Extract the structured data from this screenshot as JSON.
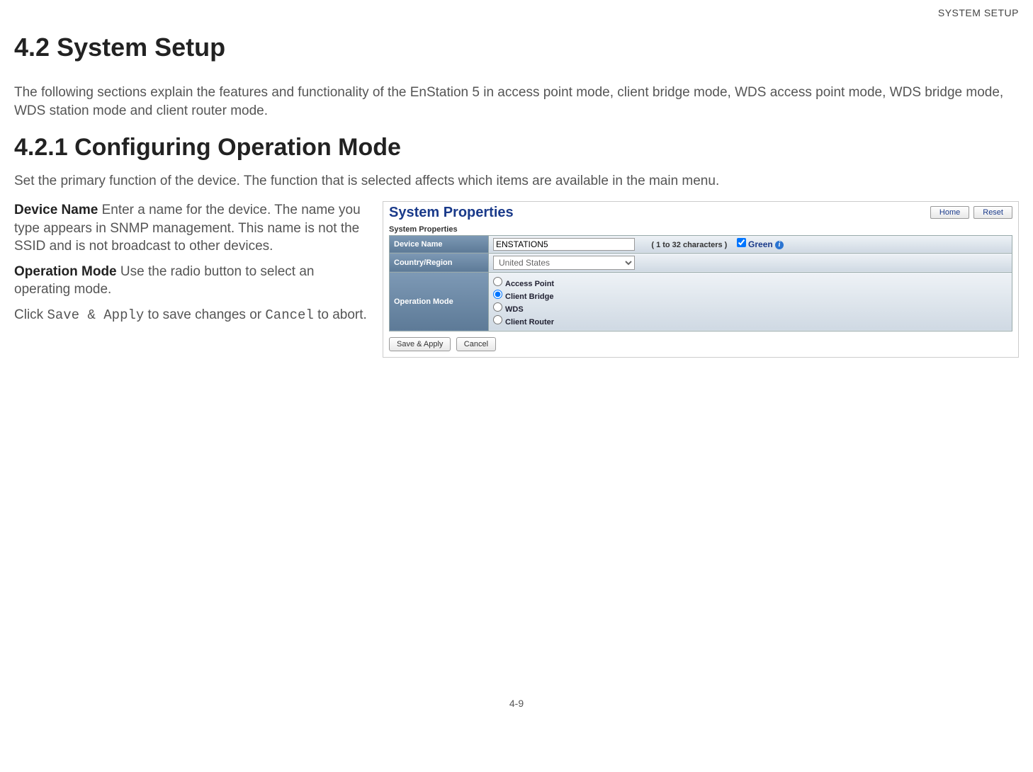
{
  "running_header": "SYSTEM SETUP",
  "section_number": "4.2",
  "section_title": "System Setup",
  "intro_para": "The following sections explain the features and functionality of the EnStation 5 in access point mode, client bridge mode, WDS access point mode, WDS bridge mode, WDS station mode and client router mode.",
  "subsection_number": "4.2.1",
  "subsection_title": "Configuring Operation Mode",
  "subsection_para": "Set the primary function of the device. The function that is selected affects which items are available in the main menu.",
  "left": {
    "device_name_label": "Device Name",
    "device_name_text": "  Enter a name for the device. The name you type appears in SNMP management. This name is not the SSID and is not broadcast to other devices.",
    "operation_mode_label": "Operation Mode",
    "operation_mode_text": "  Use the radio button to select an operating mode.",
    "click_prefix": "Click ",
    "save_apply_mono": "Save & Apply",
    "click_mid": " to save changes or ",
    "cancel_mono": "Cancel",
    "click_suffix": " to abort."
  },
  "panel": {
    "title": "System Properties",
    "home_btn": "Home",
    "reset_btn": "Reset",
    "subtitle": "System Properties",
    "rows": {
      "device_name_label": "Device Name",
      "device_name_value": "ENSTATION5",
      "device_name_hint": "( 1 to 32 characters )",
      "green_label": "Green",
      "country_label": "Country/Region",
      "country_value": "United States",
      "op_mode_label": "Operation Mode",
      "op_options": {
        "ap": "Access Point",
        "cb": "Client Bridge",
        "wds": "WDS",
        "cr": "Client Router"
      }
    },
    "save_apply_btn": "Save & Apply",
    "cancel_btn": "Cancel"
  },
  "page_number": "4-9"
}
